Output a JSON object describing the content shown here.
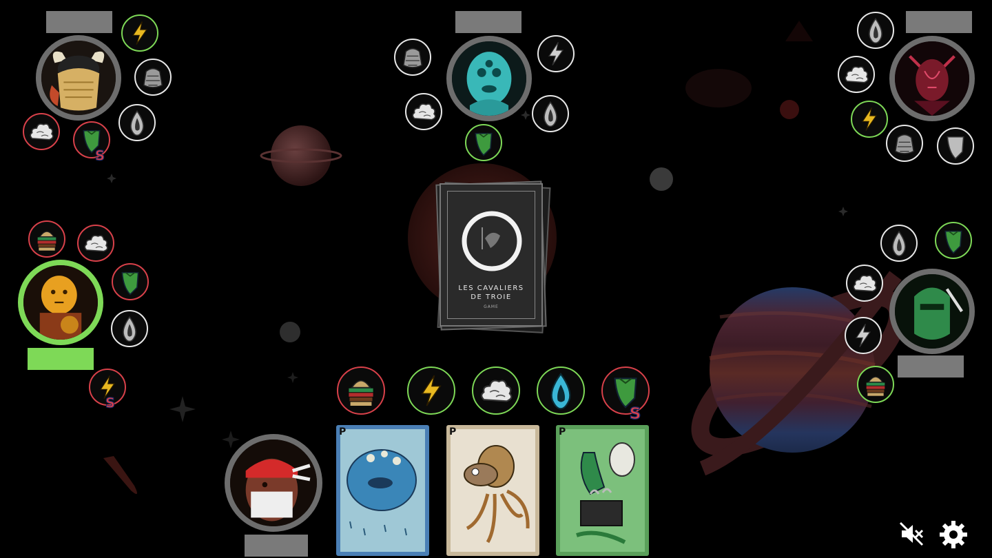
{
  "game": {
    "deck_title": "LES CAVALIERS\nDE TROIE",
    "deck_subtitle": "GAME"
  },
  "players": {
    "top_left": {
      "name": ""
    },
    "top_center": {
      "name": ""
    },
    "top_right": {
      "name": ""
    },
    "mid_left": {
      "name": "",
      "active": true
    },
    "mid_right": {
      "name": ""
    },
    "bottom": {
      "name": ""
    }
  },
  "hand": {
    "card_corner_letter": "P"
  },
  "controls": {
    "mute_icon": "speaker-muted-icon",
    "settings_icon": "gear-icon"
  },
  "colors": {
    "active_ring": "#7ed957",
    "inactive_ring": "#6d6d6d",
    "border_red": "#d9414a",
    "border_green": "#7ed957",
    "border_white": "#e8e8e8"
  }
}
